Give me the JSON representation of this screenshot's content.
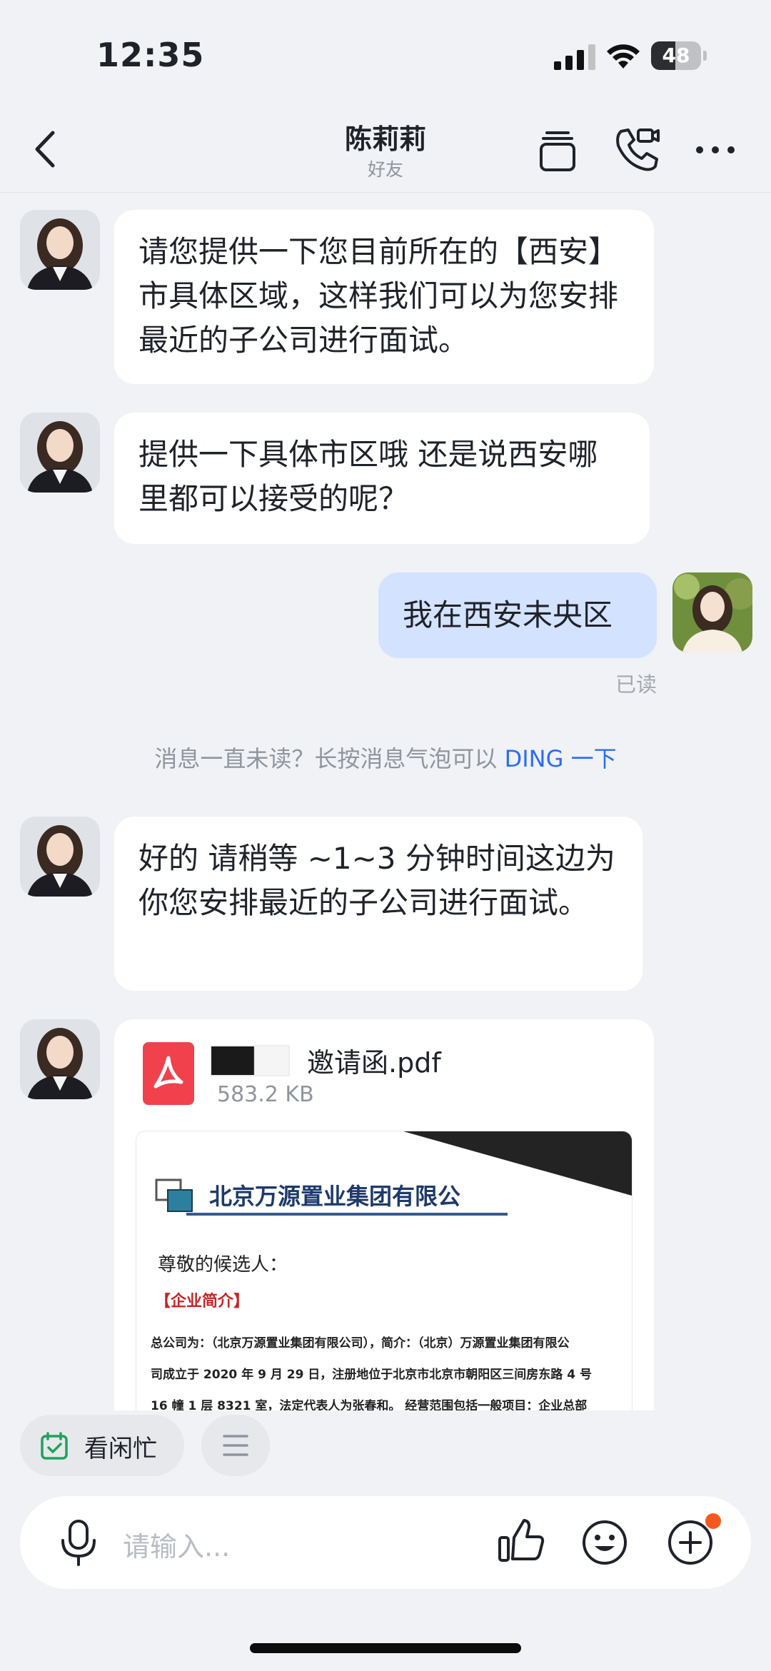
{
  "status_bar": {
    "time": "12:35",
    "battery": "48",
    "battery_level": 0.48
  },
  "header": {
    "title": "陈莉莉",
    "subtitle": "好友"
  },
  "messages": [
    {
      "text": "请您提供一下您目前所在的【西安】市具体区域，这样我们可以为您安排最近的子公司进行面试。"
    },
    {
      "text": "提供一下具体市区哦  还是说西安哪里都可以接受的呢？"
    },
    {
      "text": "我在西安未央区",
      "read_status": "已读"
    },
    {
      "text": "好的   请稍等 ~1~3 分钟时间这边为你您安排最近的子公司进行面试。"
    }
  ],
  "system_notice": {
    "text": "消息一直未读？长按消息气泡可以 ",
    "link": "DING 一下"
  },
  "file": {
    "name": "邀请函.pdf",
    "size": "583.2 KB",
    "preview": {
      "company": "北京万源置业集团有限公",
      "salutation": "尊敬的候选人：",
      "section": "【企业简介】",
      "line1": "总公司为：（北京万源置业集团有限公司），简介：（北京）万源置业集团有限公",
      "line2": "司成立于 2020 年 9 月 29 日，注册地位于北京市北京市朝阳区三间房东路 4 号",
      "line3": "16 幢 1 层 8321 室，法定代表人为张春和。  经营范围包括一般项目：企业总部"
    }
  },
  "quick_actions": {
    "availability": "看闲忙"
  },
  "input": {
    "placeholder": "请输入..."
  },
  "icons": {
    "back": "chevron-left-icon",
    "copy": "copy-icon",
    "call": "video-call-icon",
    "more": "more-icon",
    "mic": "microphone-icon",
    "like": "thumbs-up-icon",
    "emoji": "smile-icon",
    "plus": "plus-circle-icon",
    "pdf": "pdf-icon"
  },
  "colors": {
    "accent": "#2a6df4",
    "my_bubble": "#d3e2ff",
    "pdf": "#f0414d",
    "badge": "#f5591f"
  }
}
